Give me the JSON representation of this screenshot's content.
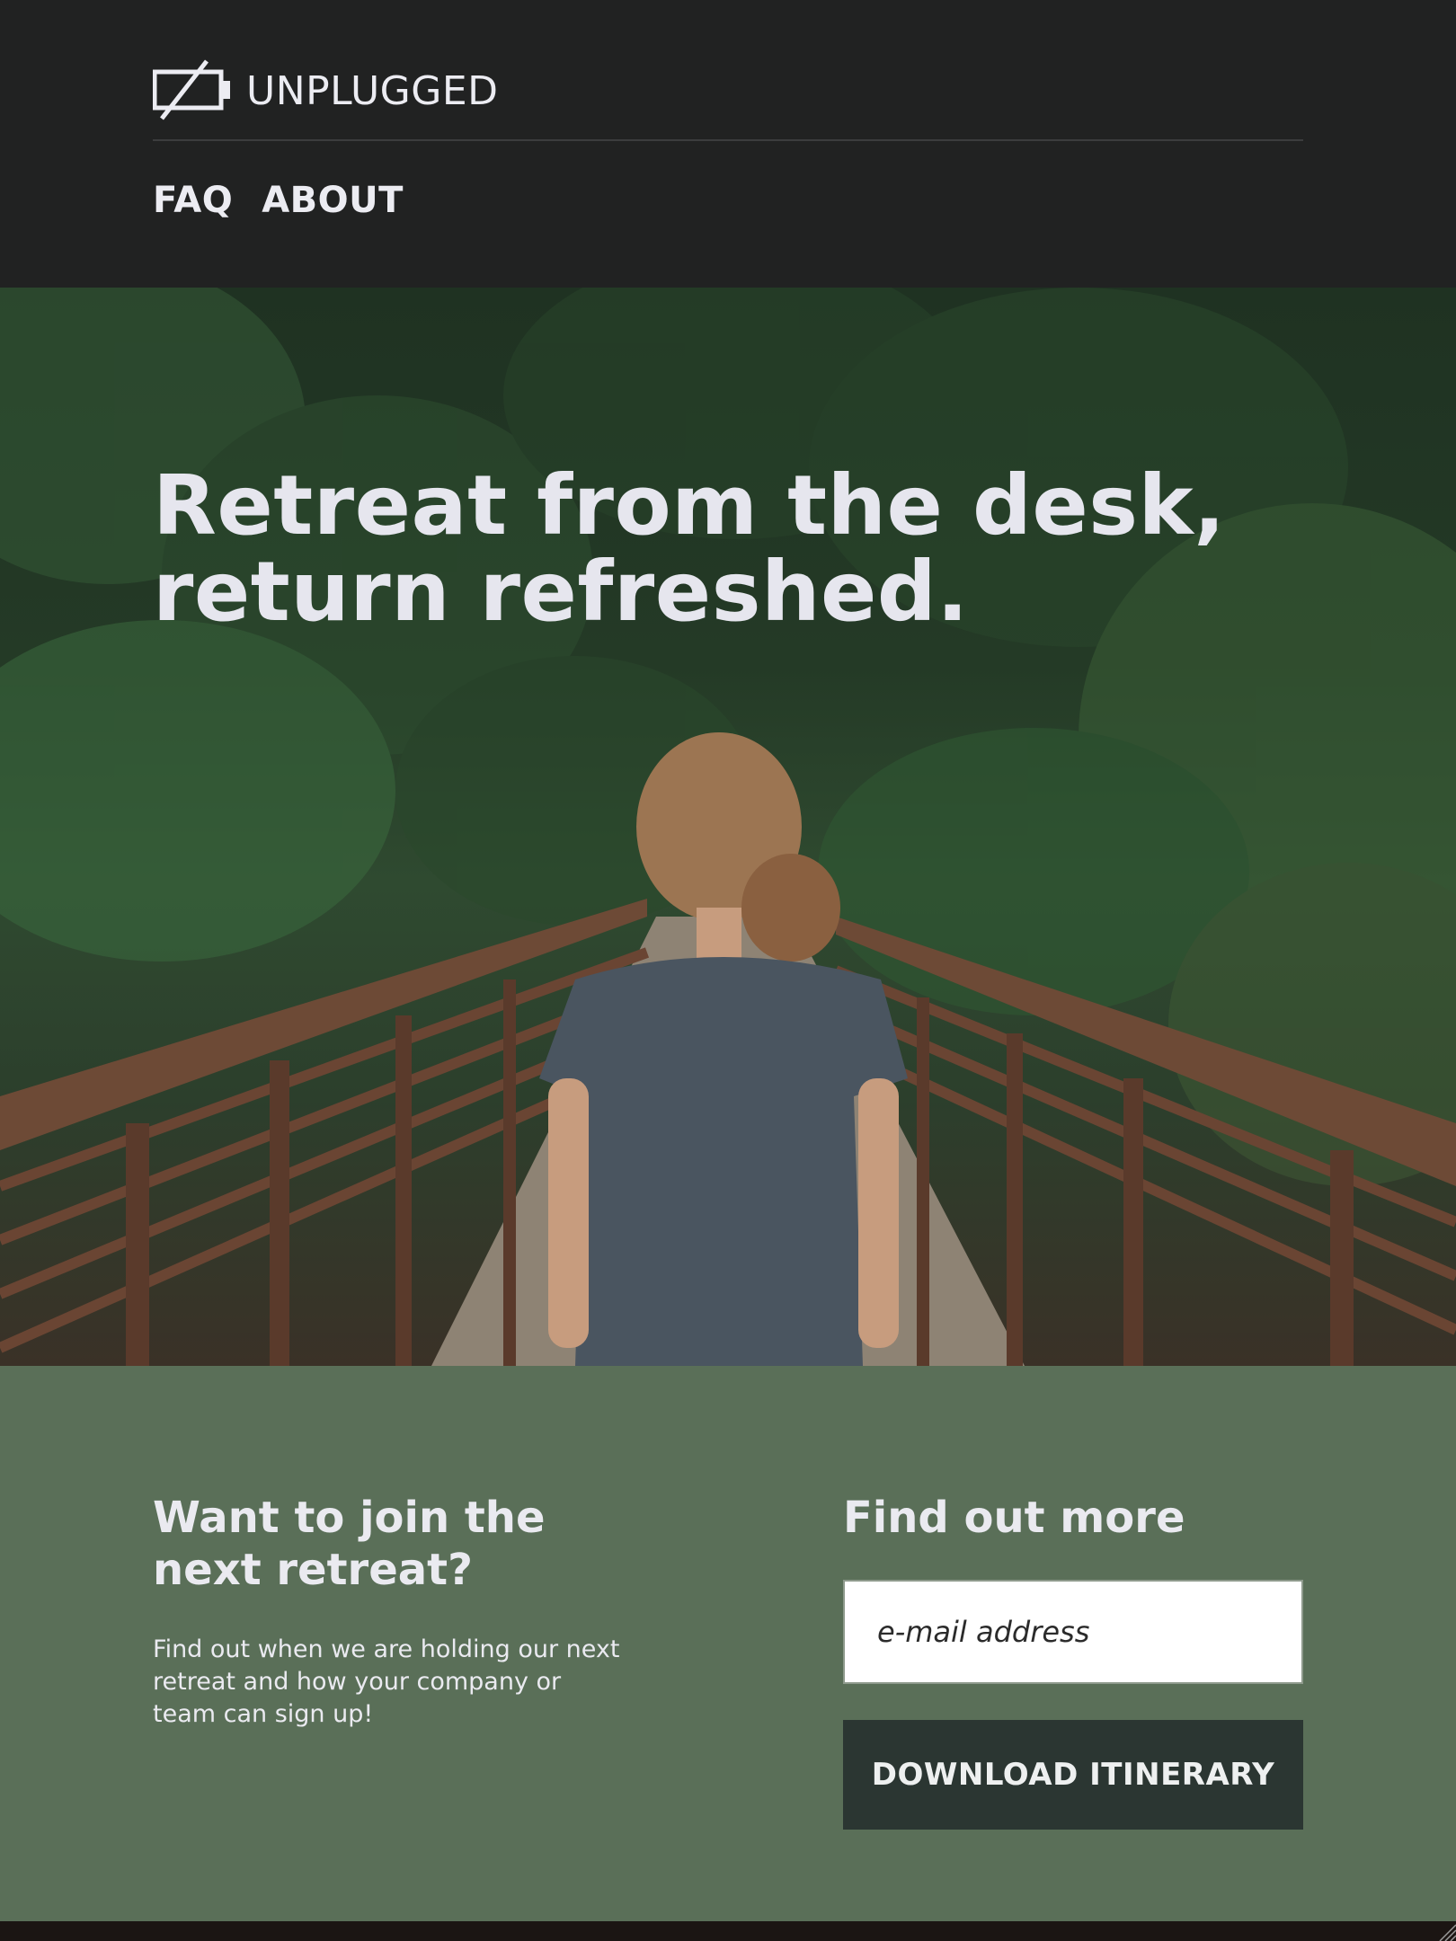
{
  "header": {
    "brand_name": "UNPLUGGED",
    "brand_icon": "battery-off-icon",
    "nav": [
      {
        "label": "FAQ"
      },
      {
        "label": "ABOUT"
      }
    ]
  },
  "hero": {
    "title_line1": "Retreat from the desk,",
    "title_line2": "return refreshed."
  },
  "cta": {
    "heading": "Want to join the next retreat?",
    "body": "Find out when we are holding our next retreat and how your company or team can sign up!",
    "form_heading": "Find out more",
    "email_placeholder": "e-mail address",
    "download_label": "DOWNLOAD ITINERARY"
  },
  "colors": {
    "header_bg": "#212222",
    "cta_bg": "#5a6f58",
    "button_bg": "#2b3632",
    "text_light": "#ececf2"
  }
}
